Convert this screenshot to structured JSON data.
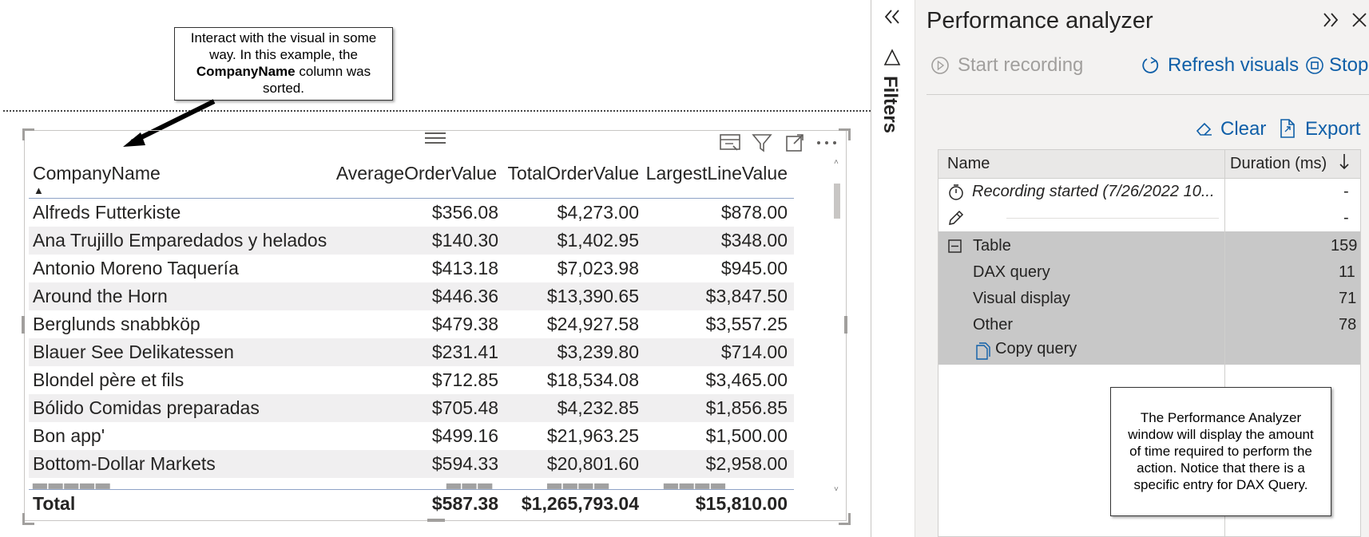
{
  "callouts": {
    "left": {
      "before": "Interact with the visual in some way. In this example, the ",
      "bold": "CompanyName",
      "after": " column was sorted."
    },
    "right": "The Performance Analyzer window will display the amount of time required to perform the action. Notice that there is a specific entry for DAX Query."
  },
  "table": {
    "columns": [
      "CompanyName",
      "AverageOrderValue",
      "TotalOrderValue",
      "LargestLineValue"
    ],
    "sort_indicator": "▲",
    "rows": [
      [
        "Alfreds Futterkiste",
        "$356.08",
        "$4,273.00",
        "$878.00"
      ],
      [
        "Ana Trujillo Emparedados y helados",
        "$140.30",
        "$1,402.95",
        "$348.00"
      ],
      [
        "Antonio Moreno Taquería",
        "$413.18",
        "$7,023.98",
        "$945.00"
      ],
      [
        "Around the Horn",
        "$446.36",
        "$13,390.65",
        "$3,847.50"
      ],
      [
        "Berglunds snabbköp",
        "$479.38",
        "$24,927.58",
        "$3,557.25"
      ],
      [
        "Blauer See Delikatessen",
        "$231.41",
        "$3,239.80",
        "$714.00"
      ],
      [
        "Blondel père et fils",
        "$712.85",
        "$18,534.08",
        "$3,465.00"
      ],
      [
        "Bólido Comidas preparadas",
        "$705.48",
        "$4,232.85",
        "$1,856.85"
      ],
      [
        "Bon app'",
        "$499.16",
        "$21,963.25",
        "$1,500.00"
      ],
      [
        "Bottom-Dollar Markets",
        "$594.33",
        "$20,801.60",
        "$2,958.00"
      ]
    ],
    "total": [
      "Total",
      "$587.38",
      "$1,265,793.04",
      "$15,810.00"
    ]
  },
  "filters_label": "Filters",
  "perf": {
    "title": "Performance analyzer",
    "start_recording": "Start recording",
    "refresh_visuals": "Refresh visuals",
    "stop": "Stop",
    "clear": "Clear",
    "export": "Export",
    "col_name": "Name",
    "col_duration": "Duration (ms)",
    "entries": [
      {
        "label": "Recording started (7/26/2022 10...",
        "value": "-"
      },
      {
        "label": "",
        "value": "-"
      },
      {
        "label": "Table",
        "value": "159"
      },
      {
        "label": "DAX query",
        "value": "11"
      },
      {
        "label": "Visual display",
        "value": "71"
      },
      {
        "label": "Other",
        "value": "78"
      }
    ],
    "copy_query": "Copy query"
  },
  "icon_names": [
    "chevrons-left-icon",
    "filter-icon",
    "chevrons-right-icon",
    "close-icon",
    "play-circle-icon",
    "refresh-icon",
    "stop-icon",
    "eraser-icon",
    "export-icon",
    "sort-down-icon",
    "timer-icon",
    "pencil-icon",
    "collapse-icon",
    "copy-icon",
    "drag-grip-icon",
    "visual-table-icon",
    "focus-mode-icon",
    "more-options-icon"
  ],
  "colors": {
    "accent": "#0f5fa8",
    "selected_block": "#c8c8c8",
    "pane_bg": "#f3f2f1"
  }
}
